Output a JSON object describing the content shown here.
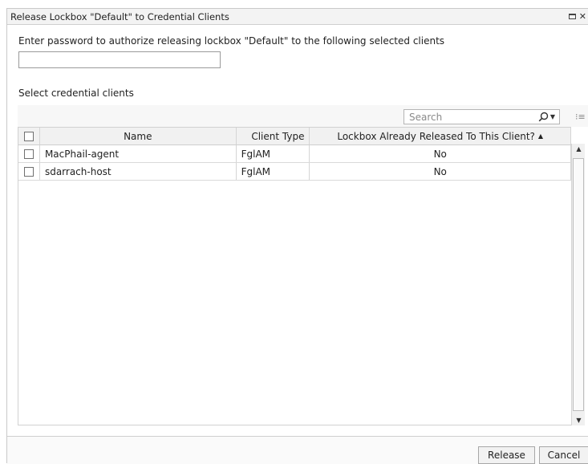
{
  "dialog": {
    "title": "Release Lockbox \"Default\" to Credential Clients",
    "icons": [
      "maximize-icon",
      "close-icon"
    ]
  },
  "form": {
    "prompt": "Enter password to authorize releasing lockbox \"Default\" to the following selected clients",
    "password_value": "",
    "section_label": "Select credential clients"
  },
  "toolbar": {
    "search_placeholder": "Search",
    "search_icon": "search-icon",
    "columns_icon": "column-chooser-icon"
  },
  "table": {
    "headers": {
      "name": "Name",
      "client_type": "Client Type",
      "released": "Lockbox Already Released To This Client?"
    },
    "sort": {
      "column": "released",
      "direction": "ascending"
    },
    "rows": [
      {
        "checked": false,
        "name": "MacPhail-agent",
        "client_type": "FglAM",
        "released": "No"
      },
      {
        "checked": false,
        "name": "sdarrach-host",
        "client_type": "FglAM",
        "released": "No"
      }
    ]
  },
  "footer": {
    "release_label": "Release",
    "cancel_label": "Cancel"
  }
}
